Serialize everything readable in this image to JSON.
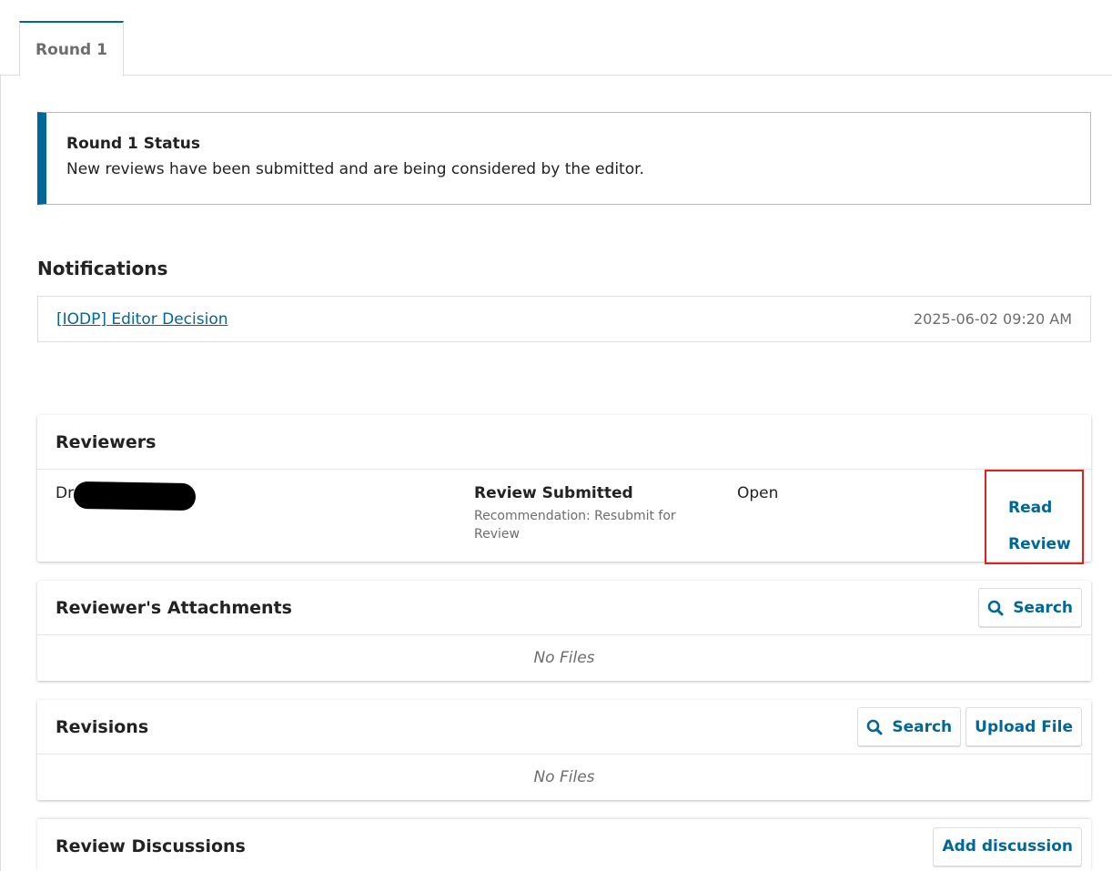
{
  "tabs": [
    {
      "label": "Round 1",
      "active": true
    }
  ],
  "status": {
    "title": "Round 1 Status",
    "text": "New reviews have been submitted and are being considered by the editor."
  },
  "notifications": {
    "heading": "Notifications",
    "items": [
      {
        "title": "[IODP] Editor Decision",
        "date": "2025-06-02 09:20 AM"
      }
    ]
  },
  "reviewers": {
    "title": "Reviewers",
    "rows": [
      {
        "name": "Dr",
        "status": "Review Submitted",
        "recommendation": "Recommendation: Resubmit for Review",
        "state": "Open",
        "action_line1": "Read",
        "action_line2": "Review"
      }
    ]
  },
  "attachments": {
    "title": "Reviewer's Attachments",
    "search_label": "Search",
    "empty": "No Files"
  },
  "revisions": {
    "title": "Revisions",
    "search_label": "Search",
    "upload_label": "Upload File",
    "empty": "No Files"
  },
  "discussions": {
    "title": "Review Discussions",
    "add_label": "Add discussion"
  },
  "colors": {
    "accent": "#006798",
    "highlight": "#e02020",
    "muted_text": "#6d6d6d",
    "border": "#dddddd"
  },
  "icons": {
    "search": "search-icon"
  }
}
